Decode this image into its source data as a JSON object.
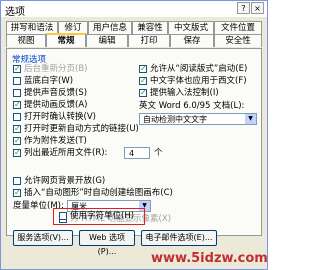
{
  "window": {
    "title": "选项",
    "help_btn": "?",
    "close_btn": "×"
  },
  "tabs_row1": [
    "拼写和语法",
    "修订",
    "用户信息",
    "兼容性",
    "中文版式",
    "文件位置"
  ],
  "tabs_row2": [
    "视图",
    "常规",
    "编辑",
    "打印",
    "保存",
    "安全性"
  ],
  "group_title": "常规选项",
  "left_options": [
    {
      "label": "后台重新分页(B)",
      "checked": true,
      "disabled": true
    },
    {
      "label": "蓝底白字(W)",
      "checked": false
    },
    {
      "label": "提供声音反馈(S)",
      "checked": false
    },
    {
      "label": "提供动画反馈(A)",
      "checked": true
    },
    {
      "label": "打开时确认转换(V)",
      "checked": false
    },
    {
      "label": "打开时更新自动方式的链接(U)",
      "checked": true
    },
    {
      "label": "作为附件发送(T)",
      "checked": true
    },
    {
      "label": "列出最近所用文件(R):",
      "checked": true
    }
  ],
  "recent_files_count": "4",
  "recent_files_unit": "个",
  "right_options": [
    {
      "label": "允许从“阅读版式”启动(E)",
      "checked": true
    },
    {
      "label": "中文字体也应用于西文(F)",
      "checked": true
    },
    {
      "label": "提供输入法控制(I)",
      "checked": true
    }
  ],
  "english_word_label": "英文 Word 6.0/95 文档(L):",
  "english_word_value": "自动检测中文文字",
  "bottom_options": [
    {
      "label": "允许网页背景开放(G)",
      "checked": false
    },
    {
      "label": "插入“自动图形”时自动创建绘图画布(C)",
      "checked": true
    }
  ],
  "measure_label": "度量单位(M):",
  "measure_value": "厘米",
  "html_option": {
    "label": "为 HTML 功能显示像素(X)",
    "checked": false,
    "disabled": true
  },
  "char_unit_option": {
    "label": "使用字符单位(H)",
    "checked": false
  },
  "buttons": [
    "服务选项(V)...",
    "Web 选项(P)...",
    "电子邮件选项(E)..."
  ],
  "watermark": "www.5idzw.com"
}
